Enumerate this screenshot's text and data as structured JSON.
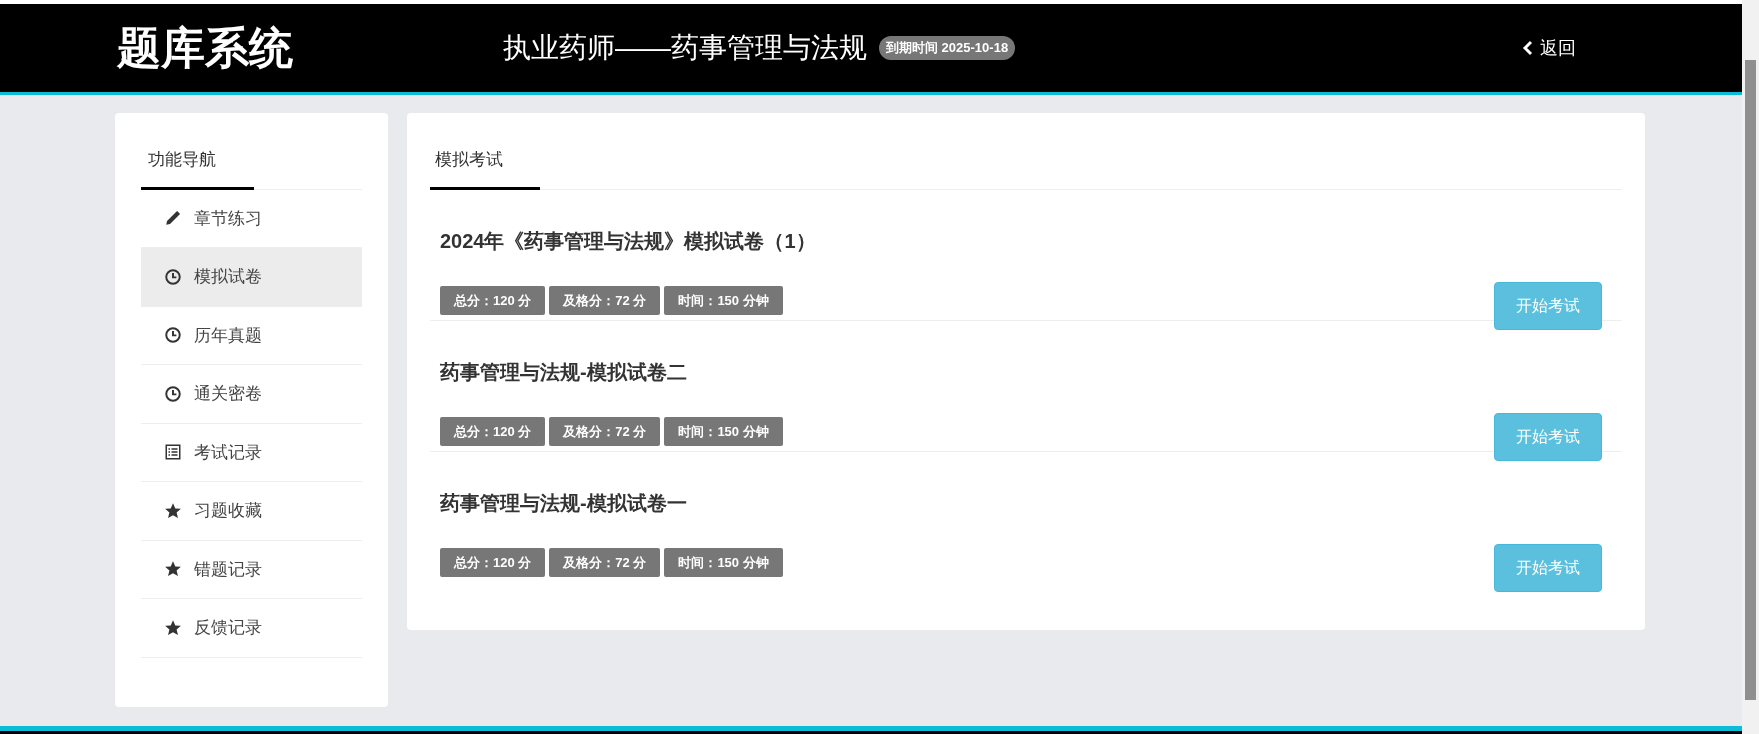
{
  "header": {
    "logo": "题库系统",
    "title": "执业药师——药事管理与法规",
    "expiry_badge": "到期时间 2025-10-18",
    "back_link": "返回"
  },
  "sidebar": {
    "heading": "功能导航",
    "items": [
      {
        "kind": "pencil",
        "label": "章节练习",
        "selected": false
      },
      {
        "kind": "clock",
        "label": "模拟试卷",
        "selected": true
      },
      {
        "kind": "clock",
        "label": "历年真题",
        "selected": false
      },
      {
        "kind": "clock",
        "label": "通关密卷",
        "selected": false
      },
      {
        "kind": "list",
        "label": "考试记录",
        "selected": false
      },
      {
        "kind": "star",
        "label": "习题收藏",
        "selected": false
      },
      {
        "kind": "star",
        "label": "错题记录",
        "selected": false
      },
      {
        "kind": "star",
        "label": "反馈记录",
        "selected": false
      }
    ]
  },
  "main": {
    "tab": "模拟考试",
    "papers": [
      {
        "title": "2024年《药事管理与法规》模拟试卷（1）",
        "tags": [
          "总分：120 分",
          "及格分：72 分",
          "时间：150 分钟"
        ],
        "button": "开始考试"
      },
      {
        "title": "药事管理与法规-模拟试卷二",
        "tags": [
          "总分：120 分",
          "及格分：72 分",
          "时间：150 分钟"
        ],
        "button": "开始考试"
      },
      {
        "title": "药事管理与法规-模拟试卷一",
        "tags": [
          "总分：120 分",
          "及格分：72 分",
          "时间：150 分钟"
        ],
        "button": "开始考试"
      }
    ]
  }
}
